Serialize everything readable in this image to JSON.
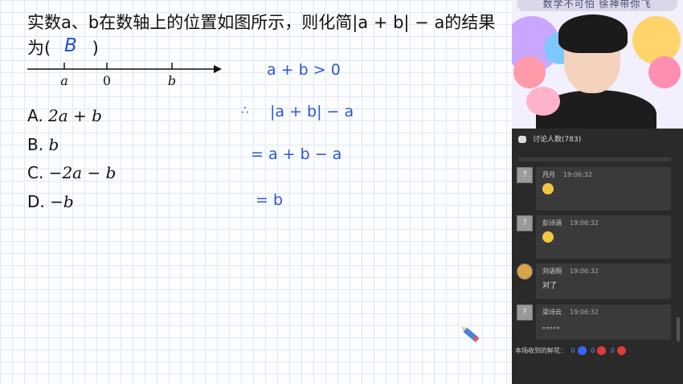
{
  "question": {
    "line1": "实数a、b在数轴上的位置如图所示，则化简|a + b| − a的结果",
    "line2_prefix": "为(",
    "line2_suffix": ")",
    "handwritten_answer": "B"
  },
  "number_line": {
    "labels": [
      "a",
      "0",
      "b"
    ]
  },
  "options": [
    {
      "letter": "A.",
      "expr": "2a + b"
    },
    {
      "letter": "B.",
      "expr": "b"
    },
    {
      "letter": "C.",
      "expr": "−2a − b"
    },
    {
      "letter": "D.",
      "expr": "−b"
    }
  ],
  "handwriting": {
    "step1": "a + b > 0",
    "step2_symbol": "∴",
    "step2": "|a + b| − a",
    "step3": "= a + b − a",
    "step4": "= b"
  },
  "video": {
    "banner": "数学不可怕 徐神带你飞"
  },
  "chat": {
    "header_label": "讨论人数",
    "participant_count": "(783)",
    "messages": [
      {
        "name": "月月",
        "time": "19:06:32",
        "body": "",
        "avatar": "?",
        "emoji": true
      },
      {
        "name": "彭诗涵",
        "time": "19:06:32",
        "body": "",
        "avatar": "?",
        "emoji": true
      },
      {
        "name": "刘语翔",
        "time": "19:06:32",
        "body": "对了",
        "avatar": "",
        "emoji": false
      },
      {
        "name": "梁诗云",
        "time": "19:06:32",
        "body": "。。。。。",
        "avatar": "?",
        "emoji": false
      }
    ],
    "footer_label": "本场收到的鲜花：",
    "flowers": [
      {
        "count": "0",
        "color": "#3b63ff"
      },
      {
        "count": "0",
        "color": "#e03a3a"
      },
      {
        "count": "0",
        "color": "#e03a3a"
      }
    ]
  },
  "colors": {
    "handwriting": "#2f56d9",
    "chat_bg": "#2a2a2a",
    "chat_card": "#3a3a3a"
  }
}
